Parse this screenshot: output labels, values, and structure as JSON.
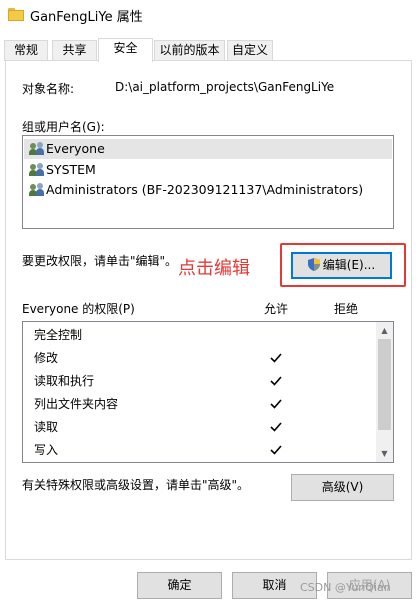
{
  "window": {
    "title": "GanFengLiYe 属性"
  },
  "tabs": [
    {
      "label": "常规"
    },
    {
      "label": "共享"
    },
    {
      "label": "安全"
    },
    {
      "label": "以前的版本"
    },
    {
      "label": "自定义"
    }
  ],
  "security": {
    "object_label": "对象名称:",
    "object_value": "D:\\ai_platform_projects\\GanFengLiYe",
    "group_label": "组或用户名(G):",
    "users": [
      {
        "name": "Everyone"
      },
      {
        "name": "SYSTEM"
      },
      {
        "name": "Administrators (BF-202309121137\\Administrators)"
      }
    ],
    "change_hint": "要更改权限，请单击\"编辑\"。",
    "edit_button": "编辑(E)...",
    "annotation": "点击编辑",
    "perm_header": "Everyone 的权限(P)",
    "allow_header": "允许",
    "deny_header": "拒绝",
    "permissions": [
      {
        "name": "完全控制",
        "allow": false,
        "deny": false
      },
      {
        "name": "修改",
        "allow": true,
        "deny": false
      },
      {
        "name": "读取和执行",
        "allow": true,
        "deny": false
      },
      {
        "name": "列出文件夹内容",
        "allow": true,
        "deny": false
      },
      {
        "name": "读取",
        "allow": true,
        "deny": false
      },
      {
        "name": "写入",
        "allow": true,
        "deny": false
      }
    ],
    "advanced_hint": "有关特殊权限或高级设置，请单击\"高级\"。",
    "advanced_button": "高级(V)"
  },
  "footer": {
    "ok": "确定",
    "cancel": "取消",
    "apply": "应用(A)"
  },
  "watermark": "CSDN @YunQian",
  "colors": {
    "annotation": "#e53935",
    "focus": "#0078d7"
  }
}
